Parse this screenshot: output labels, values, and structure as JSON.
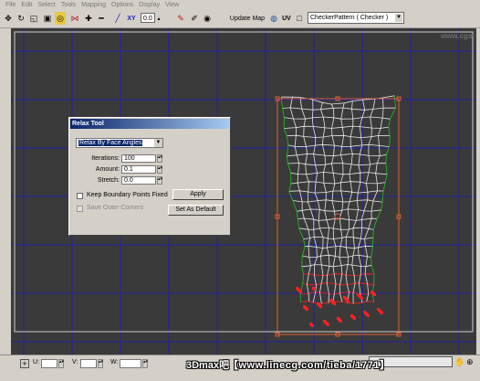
{
  "menu": [
    "File",
    "Edit",
    "Select",
    "Tools",
    "Mapping",
    "Options",
    "Display",
    "View"
  ],
  "toolbar": {
    "coord_label": "XY",
    "offset_value": "0.0",
    "update_map_label": "Update Map",
    "uv_label": "UV",
    "texture_dropdown": "CheckerPattern  ( Checker )"
  },
  "viewport": {
    "watermark_corner": "www.cgat"
  },
  "relax_tool": {
    "title": "Relax Tool",
    "mode": "Relax By Face Angles",
    "iterations_label": "Iterations:",
    "iterations_value": "100",
    "amount_label": "Amount:",
    "amount_value": "0.1",
    "stretch_label": "Stretch:",
    "stretch_value": "0.0",
    "keep_boundary_label": "Keep Boundary Points Fixed",
    "save_outer_label": "Save Outer Corners",
    "apply_label": "Apply",
    "set_default_label": "Set As Default"
  },
  "status": {
    "u_label": "U:",
    "v_label": "V:",
    "w_label": "W:",
    "brand": "3Dmax吧",
    "url": "【www.linecg.com/tieba/1771】"
  },
  "colors": {
    "grid": "#2020a0",
    "mesh": "#e8e8e8",
    "seam_red": "#ff2020",
    "seam_green": "#20c020",
    "gizmo": "#e06030"
  }
}
